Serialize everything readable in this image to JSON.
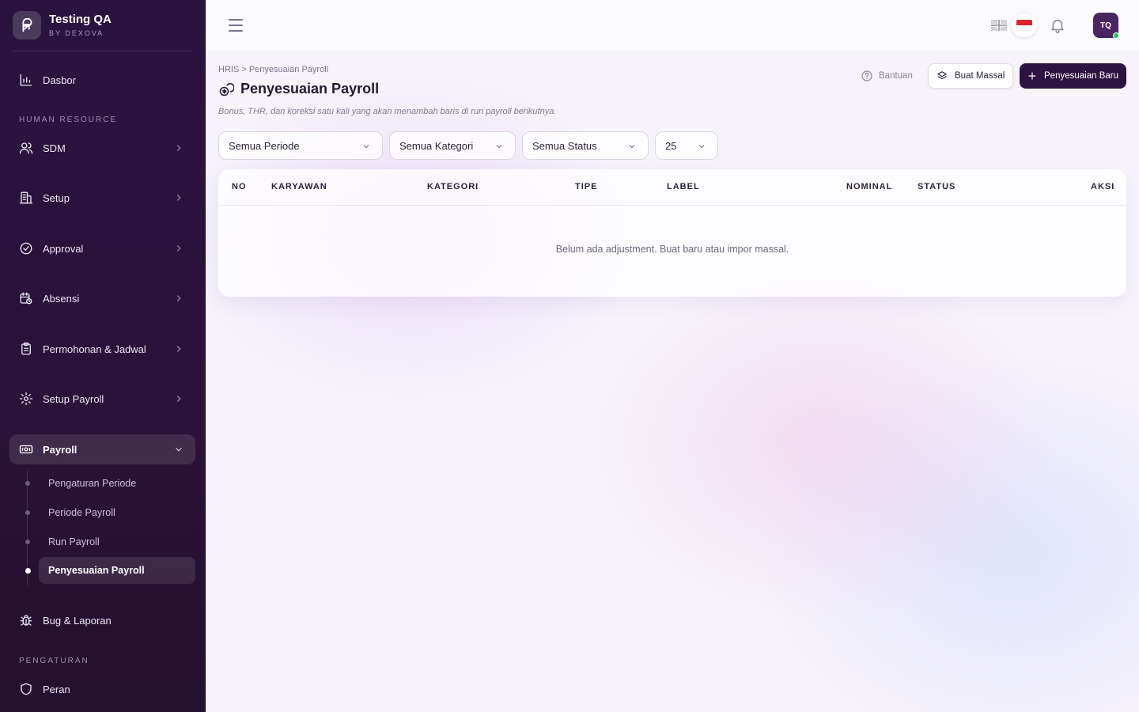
{
  "app": {
    "name": "Testing QA",
    "sub": "BY DEXOVA"
  },
  "sidebar": {
    "dashboard": "Dasbor",
    "section_hr": "HUMAN RESOURCE",
    "items": [
      {
        "label": "SDM",
        "icon": "users-icon"
      },
      {
        "label": "Setup",
        "icon": "building-icon"
      },
      {
        "label": "Approval",
        "icon": "check-circle-icon"
      },
      {
        "label": "Absensi",
        "icon": "calendar-clock-icon"
      },
      {
        "label": "Permohonan & Jadwal",
        "icon": "clipboard-icon"
      },
      {
        "label": "Setup Payroll",
        "icon": "gear-icon"
      },
      {
        "label": "Payroll",
        "icon": "banknote-icon",
        "active": true
      }
    ],
    "payroll_sub": [
      {
        "label": "Pengaturan Periode"
      },
      {
        "label": "Periode Payroll"
      },
      {
        "label": "Run Payroll"
      },
      {
        "label": "Penyesuaian Payroll",
        "active": true
      }
    ],
    "bug": "Bug & Laporan",
    "section_settings": "PENGATURAN",
    "role": "Peran"
  },
  "topbar": {
    "avatar_initials": "TQ",
    "languages": [
      "EN",
      "ID"
    ],
    "online_color": "#22c55e"
  },
  "page": {
    "breadcrumb": "HRIS > Penyesuaian Payroll",
    "title": "Penyesuaian Payroll",
    "description": "Bonus, THR, dan koreksi satu kali yang akan menambah baris di run payroll berikutnya.",
    "help_label": "Bantuan",
    "mass_label": "Buat Massal",
    "new_label": "Penyesuaian Baru"
  },
  "filters": {
    "period": "Semua Periode",
    "category": "Semua Kategori",
    "status": "Semua Status",
    "per_page": "25"
  },
  "table": {
    "columns": [
      "NO",
      "KARYAWAN",
      "KATEGORI",
      "TIPE",
      "LABEL",
      "NOMINAL",
      "STATUS",
      "AKSI"
    ],
    "rows": [],
    "empty_text": "Belum ada adjustment. Buat baru atau impor massal."
  },
  "colors": {
    "sidebar_bg": "#2b1340",
    "primary": "#2c1342",
    "accent": "#4b2560"
  }
}
